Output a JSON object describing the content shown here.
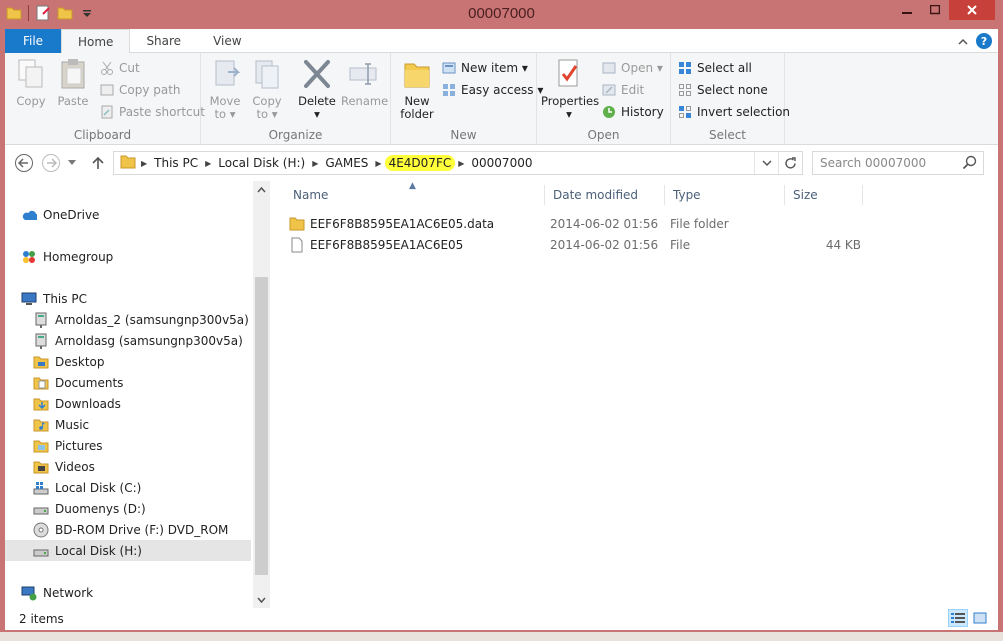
{
  "window": {
    "title": "00007000"
  },
  "ribbon_tabs": {
    "file": "File",
    "home": "Home",
    "share": "Share",
    "view": "View"
  },
  "clipboard": {
    "copy": "Copy",
    "paste": "Paste",
    "cut": "Cut",
    "copy_path": "Copy path",
    "paste_shortcut": "Paste shortcut",
    "label": "Clipboard"
  },
  "organize": {
    "move_to_1": "Move",
    "move_to_2": "to ▾",
    "copy_to_1": "Copy",
    "copy_to_2": "to ▾",
    "delete_1": "Delete",
    "delete_2": "▾",
    "rename": "Rename",
    "label": "Organize"
  },
  "new_group": {
    "new_folder_1": "New",
    "new_folder_2": "folder",
    "new_item": "New item ▾",
    "easy_access": "Easy access ▾",
    "label": "New"
  },
  "open_group": {
    "properties": "Properties",
    "properties_arrow": "▾",
    "open": "Open ▾",
    "edit": "Edit",
    "history": "History",
    "label": "Open"
  },
  "select_group": {
    "select_all": "Select all",
    "select_none": "Select none",
    "invert_selection": "Invert selection",
    "label": "Select"
  },
  "address": {
    "crumbs": [
      "This PC",
      "Local Disk (H:)",
      "GAMES",
      "4E4D07FC",
      "00007000"
    ],
    "highlight_color": "#ffff3a"
  },
  "search": {
    "placeholder": "Search 00007000"
  },
  "navpane": {
    "onedrive": "OneDrive",
    "homegroup": "Homegroup",
    "thispc": "This PC",
    "items": [
      "Arnoldas_2 (samsungnp300v5a)",
      "Arnoldasg (samsungnp300v5a)",
      "Desktop",
      "Documents",
      "Downloads",
      "Music",
      "Pictures",
      "Videos",
      "Local Disk (C:)",
      "Duomenys (D:)",
      "BD-ROM Drive (F:) DVD_ROM",
      "Local Disk (H:)"
    ],
    "network": "Network"
  },
  "columns": {
    "name": "Name",
    "date": "Date modified",
    "type": "Type",
    "size": "Size"
  },
  "files": [
    {
      "name": "EEF6F8B8595EA1AC6E05.data",
      "date": "2014-06-02 01:56",
      "type": "File folder",
      "size": ""
    },
    {
      "name": "EEF6F8B8595EA1AC6E05",
      "date": "2014-06-02 01:56",
      "type": "File",
      "size": "44 KB"
    }
  ],
  "status": {
    "items": "2 items"
  }
}
